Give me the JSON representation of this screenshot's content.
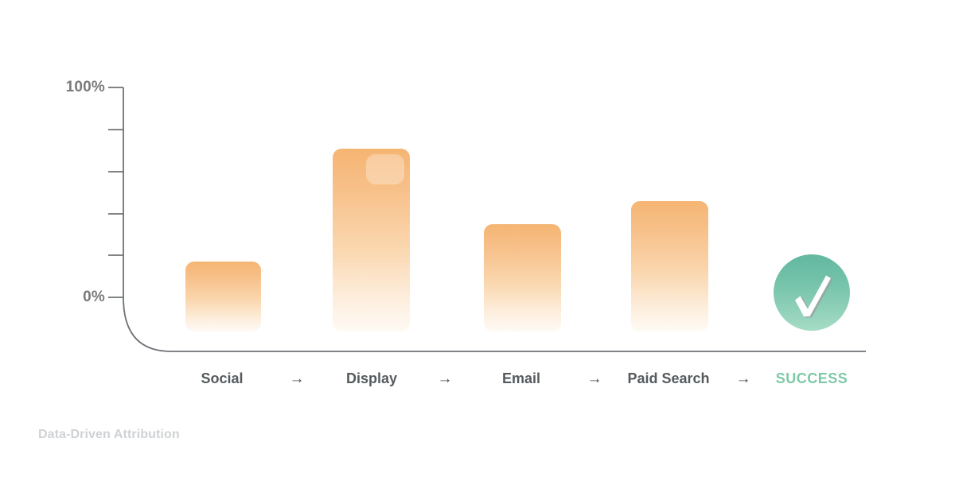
{
  "caption": "Data-Driven Attribution",
  "colors": {
    "bar_top": "#f5b573",
    "bar_bottom": "#fefaf5",
    "axis": "#6f7276",
    "tick_text": "#7a7a7a",
    "xlabel_text": "#555a5e",
    "success_green": "#7fc8a9",
    "success_circle_top": "#63b8a0",
    "success_circle_bottom": "#a6dcc6",
    "caption_text": "#cfd2d4",
    "background": "#ffffff"
  },
  "axis": {
    "y_top_label": "100%",
    "y_bottom_label": "0%",
    "tick_count": 6,
    "arrow_glyph": "→"
  },
  "success": {
    "label": "SUCCESS",
    "icon": "checkmark-icon"
  },
  "chart_data": {
    "type": "bar",
    "title": "Data-Driven Attribution",
    "xlabel": "",
    "ylabel": "",
    "ylim": [
      0,
      100
    ],
    "grid": false,
    "legend": false,
    "categories": [
      "Social",
      "Display",
      "Email",
      "Paid Search"
    ],
    "values": [
      17,
      71,
      35,
      46
    ],
    "value_unit": "%",
    "tick_labels": [
      "0%",
      "100%"
    ],
    "annotations": [
      {
        "text": "SUCCESS",
        "type": "endpoint-badge",
        "color": "#7fc8a9"
      },
      {
        "text": "→",
        "type": "flow-arrow",
        "count": 4
      }
    ],
    "flow_sequence": [
      "Social",
      "→",
      "Display",
      "→",
      "Email",
      "→",
      "Paid Search",
      "→",
      "SUCCESS"
    ]
  }
}
